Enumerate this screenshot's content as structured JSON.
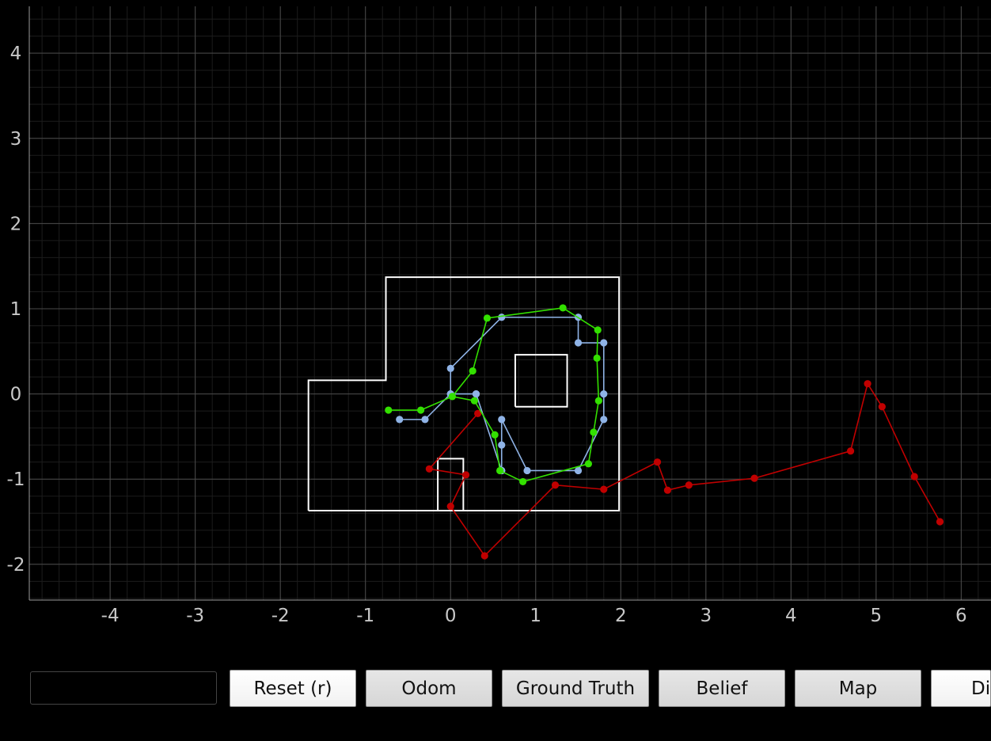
{
  "chart_data": {
    "type": "line",
    "xlim": [
      -4.95,
      6.35
    ],
    "ylim": [
      -2.42,
      4.55
    ],
    "x_ticks": [
      "-4",
      "-3",
      "-2",
      "-1",
      "0",
      "1",
      "2",
      "3",
      "4",
      "5",
      "6"
    ],
    "y_ticks": [
      "-2",
      "-1",
      "0",
      "1",
      "2",
      "3",
      "4"
    ],
    "grid": true,
    "map_walls": [
      [
        [
          -1.67,
          -1.37
        ],
        [
          1.98,
          -1.37
        ],
        [
          1.98,
          1.37
        ],
        [
          -0.76,
          1.37
        ],
        [
          -0.76,
          0.16
        ],
        [
          -1.67,
          0.16
        ],
        [
          -1.67,
          -1.37
        ]
      ],
      [
        [
          0.76,
          -0.15
        ],
        [
          1.37,
          -0.15
        ],
        [
          1.37,
          0.46
        ],
        [
          0.76,
          0.46
        ],
        [
          0.76,
          -0.15
        ]
      ],
      [
        [
          -0.15,
          -1.37
        ],
        [
          -0.15,
          -0.76
        ],
        [
          0.15,
          -0.76
        ],
        [
          0.15,
          -1.37
        ]
      ]
    ],
    "series": [
      {
        "color": "#c00000",
        "x": [
          0.32,
          -0.25,
          0.18,
          0.0,
          0.4,
          1.23,
          1.8,
          2.43,
          2.55,
          2.8,
          3.57,
          4.7,
          4.9,
          5.07,
          5.45,
          5.75
        ],
        "y": [
          -0.23,
          -0.88,
          -0.95,
          -1.32,
          -1.9,
          -1.07,
          -1.12,
          -0.8,
          -1.13,
          -1.07,
          -0.99,
          -0.67,
          0.12,
          -0.15,
          -0.97,
          -1.5
        ]
      },
      {
        "color": "#8fb3e6",
        "x": [
          -0.6,
          -0.3,
          0.0,
          0.3,
          0.6,
          0.6,
          0.6,
          0.9,
          1.5,
          1.8,
          1.8,
          1.8,
          1.5,
          1.5,
          0.6,
          0.0,
          0.0,
          0.3,
          0.6,
          0.6
        ],
        "y": [
          -0.3,
          -0.3,
          0.0,
          0.0,
          -0.9,
          -0.6,
          -0.3,
          -0.9,
          -0.9,
          -0.3,
          0.0,
          0.6,
          0.6,
          0.9,
          0.9,
          0.3,
          0.0,
          0.0,
          -0.9,
          -0.9
        ]
      },
      {
        "color": "#33e000",
        "x": [
          -0.73,
          -0.35,
          0.02,
          0.28,
          0.52,
          0.58,
          0.85,
          1.62,
          1.68,
          1.74,
          1.72,
          1.73,
          1.32,
          0.43,
          0.26,
          0.02
        ],
        "y": [
          -0.19,
          -0.19,
          -0.03,
          -0.08,
          -0.48,
          -0.9,
          -1.03,
          -0.82,
          -0.45,
          -0.08,
          0.42,
          0.75,
          1.01,
          0.89,
          0.27,
          -0.03
        ]
      }
    ]
  },
  "toolbar": {
    "input_value": "",
    "reset_label": "Reset (r)",
    "odom_label": "Odom",
    "ground_truth_label": "Ground Truth",
    "belief_label": "Belief",
    "map_label": "Map",
    "dist_label": "Di"
  }
}
